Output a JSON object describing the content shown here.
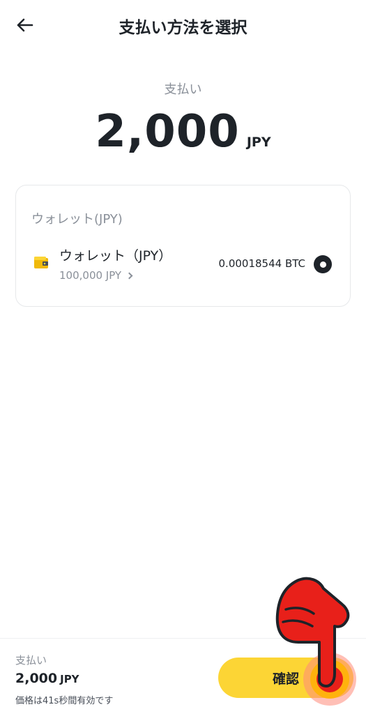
{
  "header": {
    "title": "支払い方法を選択",
    "back_icon": "arrow-left-icon"
  },
  "payment": {
    "label": "支払い",
    "amount": "2,000",
    "currency": "JPY"
  },
  "wallet_section": {
    "title": "ウォレット(JPY)",
    "method": {
      "icon": "wallet-icon",
      "name": "ウォレット（JPY）",
      "balance": "100,000 JPY",
      "crypto_amount": "0.00018544 BTC",
      "selected": true
    }
  },
  "bottom_bar": {
    "label": "支払い",
    "amount": "2,000",
    "currency": "JPY",
    "validity_note": "価格は41s秒間有効です",
    "confirm_label": "確認"
  },
  "colors": {
    "accent": "#fcd535",
    "text_primary": "#1e2329",
    "text_secondary": "#8a9099",
    "pointer_red": "#e8201a"
  }
}
